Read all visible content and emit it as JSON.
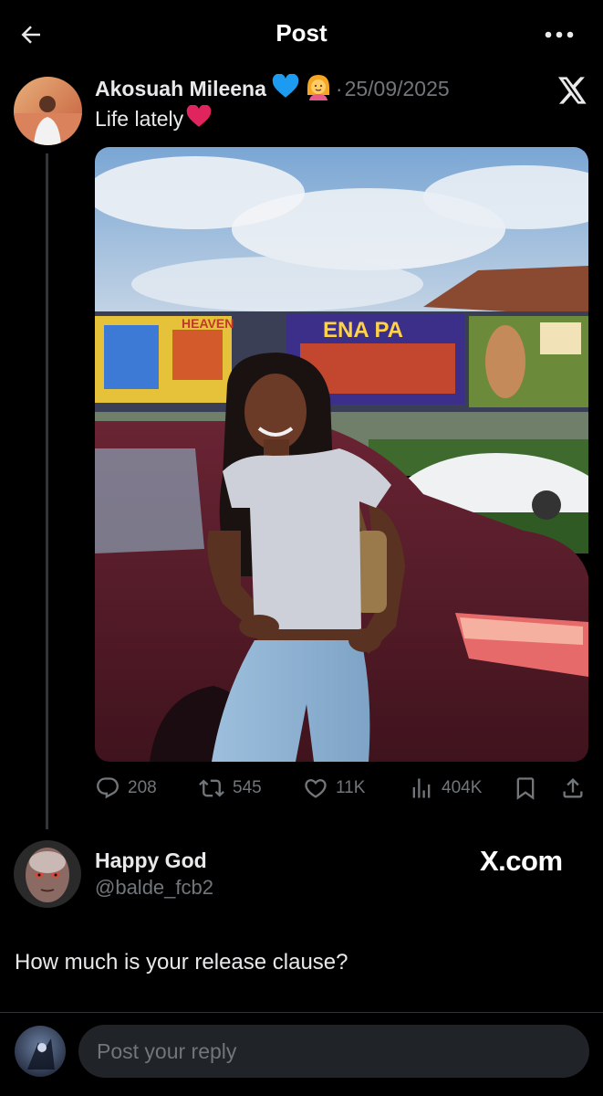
{
  "header": {
    "title": "Post"
  },
  "post": {
    "author_name": "Akosuah Mileena",
    "date_sep": "·",
    "date": "25/09/2025",
    "text": "Life lately",
    "actions": {
      "replies": "208",
      "reposts": "545",
      "likes": "11K",
      "views": "404K"
    },
    "image_labels": {
      "billboard_left": "HEAVEN",
      "billboard_center": "ENA PA"
    }
  },
  "reply": {
    "author_name": "Happy God",
    "handle": "@balde_fcb2",
    "watermark": "X.com",
    "text": "How much is your release clause?"
  },
  "composer": {
    "placeholder": "Post your reply"
  },
  "colors": {
    "background": "#000000",
    "primary_text": "#e7e9ea",
    "secondary_text": "#71767b",
    "input_bg": "#202327",
    "heart_red": "#e0245e",
    "blue_heart": "#1d9bf0"
  },
  "icons": [
    "back-arrow-icon",
    "more-dots-icon",
    "x-logo-icon",
    "blue-heart-emoji",
    "person-emoji",
    "red-heart-emoji",
    "reply-icon",
    "repost-icon",
    "like-icon",
    "views-icon",
    "bookmark-icon",
    "share-icon"
  ]
}
